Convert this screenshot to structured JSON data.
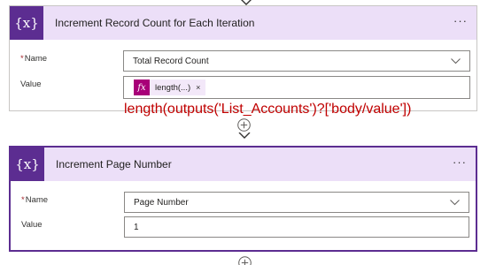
{
  "cards": [
    {
      "icon_label": "{x}",
      "title": "Increment Record Count for Each Iteration",
      "more_label": "···",
      "name_label": "Name",
      "name_required_mark": "*",
      "name_value": "Total Record Count",
      "value_label": "Value",
      "value_token": {
        "icon_label": "fx",
        "label": "length(...)",
        "remove_label": "×"
      }
    },
    {
      "icon_label": "{x}",
      "title": "Increment Page Number",
      "more_label": "···",
      "name_label": "Name",
      "name_required_mark": "*",
      "name_value": "Page Number",
      "value_label": "Value",
      "value_text": "1"
    }
  ],
  "annotation": "length(outputs('List_Accounts')?['body/value'])",
  "icons": [
    "variable-icon",
    "more-options-icon",
    "chevron-down-icon",
    "expression-fx-icon",
    "remove-icon",
    "arrow-down-icon",
    "add-step-icon"
  ],
  "colors": {
    "variable_icon_bg": "#5c2d91",
    "header_bg": "#ecdff8",
    "selected_border": "#5c2d91",
    "expression_icon_bg": "#a80078",
    "annotation_text": "#c00000",
    "required_mark": "#a4262c"
  }
}
